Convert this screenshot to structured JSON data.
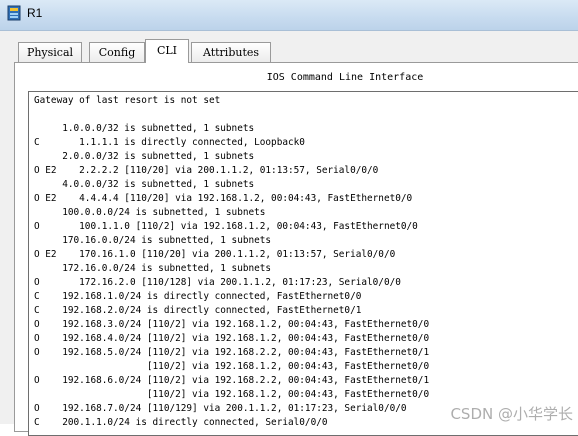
{
  "window": {
    "title": "R1",
    "icon": "router-app-icon"
  },
  "tabs": [
    {
      "label": "Physical",
      "active": false
    },
    {
      "label": "Config",
      "active": false
    },
    {
      "label": "CLI",
      "active": true
    },
    {
      "label": "Attributes",
      "active": false
    }
  ],
  "cli": {
    "heading": "IOS Command Line Interface",
    "lines": [
      "Gateway of last resort is not set",
      "",
      "     1.0.0.0/32 is subnetted, 1 subnets",
      "C       1.1.1.1 is directly connected, Loopback0",
      "     2.0.0.0/32 is subnetted, 1 subnets",
      "O E2    2.2.2.2 [110/20] via 200.1.1.2, 01:13:57, Serial0/0/0",
      "     4.0.0.0/32 is subnetted, 1 subnets",
      "O E2    4.4.4.4 [110/20] via 192.168.1.2, 00:04:43, FastEthernet0/0",
      "     100.0.0.0/24 is subnetted, 1 subnets",
      "O       100.1.1.0 [110/2] via 192.168.1.2, 00:04:43, FastEthernet0/0",
      "     170.16.0.0/24 is subnetted, 1 subnets",
      "O E2    170.16.1.0 [110/20] via 200.1.1.2, 01:13:57, Serial0/0/0",
      "     172.16.0.0/24 is subnetted, 1 subnets",
      "O       172.16.2.0 [110/128] via 200.1.1.2, 01:17:23, Serial0/0/0",
      "C    192.168.1.0/24 is directly connected, FastEthernet0/0",
      "C    192.168.2.0/24 is directly connected, FastEthernet0/1",
      "O    192.168.3.0/24 [110/2] via 192.168.1.2, 00:04:43, FastEthernet0/0",
      "O    192.168.4.0/24 [110/2] via 192.168.1.2, 00:04:43, FastEthernet0/0",
      "O    192.168.5.0/24 [110/2] via 192.168.2.2, 00:04:43, FastEthernet0/1",
      "                    [110/2] via 192.168.1.2, 00:04:43, FastEthernet0/0",
      "O    192.168.6.0/24 [110/2] via 192.168.2.2, 00:04:43, FastEthernet0/1",
      "                    [110/2] via 192.168.1.2, 00:04:43, FastEthernet0/0",
      "O    192.168.7.0/24 [110/129] via 200.1.1.2, 01:17:23, Serial0/0/0",
      "C    200.1.1.0/24 is directly connected, Serial0/0/0"
    ]
  },
  "watermark": "CSDN @小华学长"
}
